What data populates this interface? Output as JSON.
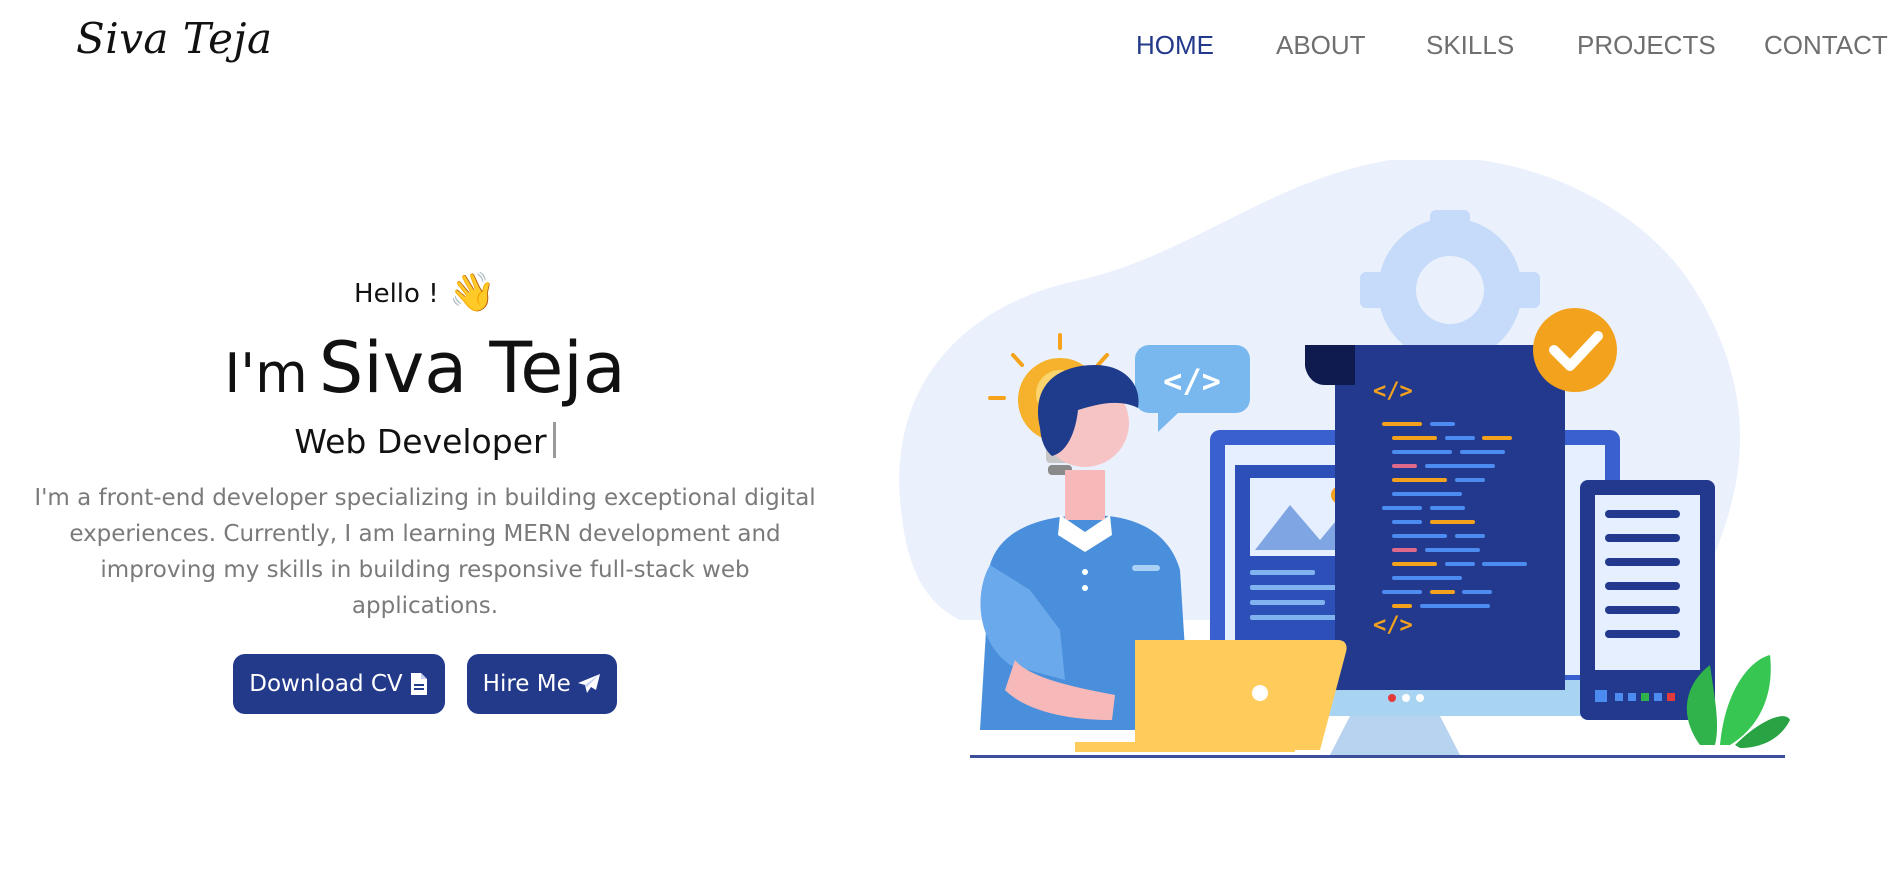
{
  "brand": {
    "logo_text": "Siva Teja"
  },
  "nav": {
    "items": [
      {
        "label": "HOME",
        "active": true
      },
      {
        "label": "ABOUT",
        "active": false
      },
      {
        "label": "SKILLS",
        "active": false
      },
      {
        "label": "PROJECTS",
        "active": false
      },
      {
        "label": "CONTACT",
        "active": false
      }
    ]
  },
  "hero": {
    "greeting": "Hello !",
    "wave_emoji": "👋",
    "intro_prefix": "I'm",
    "name": "Siva Teja",
    "role": "Web Developer",
    "bio": "I'm a front-end developer specializing in building exceptional digital experiences. Currently, I am learning MERN development and improving my skills in building responsive full-stack web applications.",
    "buttons": {
      "download_cv": {
        "label": "Download CV",
        "icon": "file-icon"
      },
      "hire_me": {
        "label": "Hire Me",
        "icon": "paper-plane-icon"
      }
    }
  },
  "illustration": {
    "code_bubble_text": "</>",
    "code_tag_text": "</>"
  },
  "colors": {
    "primary": "#23398a",
    "nav_text": "#6f6f6f",
    "body_text": "#7a7a7a",
    "accent_orange": "#f3a21d",
    "light_blue": "#eaf1fd"
  }
}
